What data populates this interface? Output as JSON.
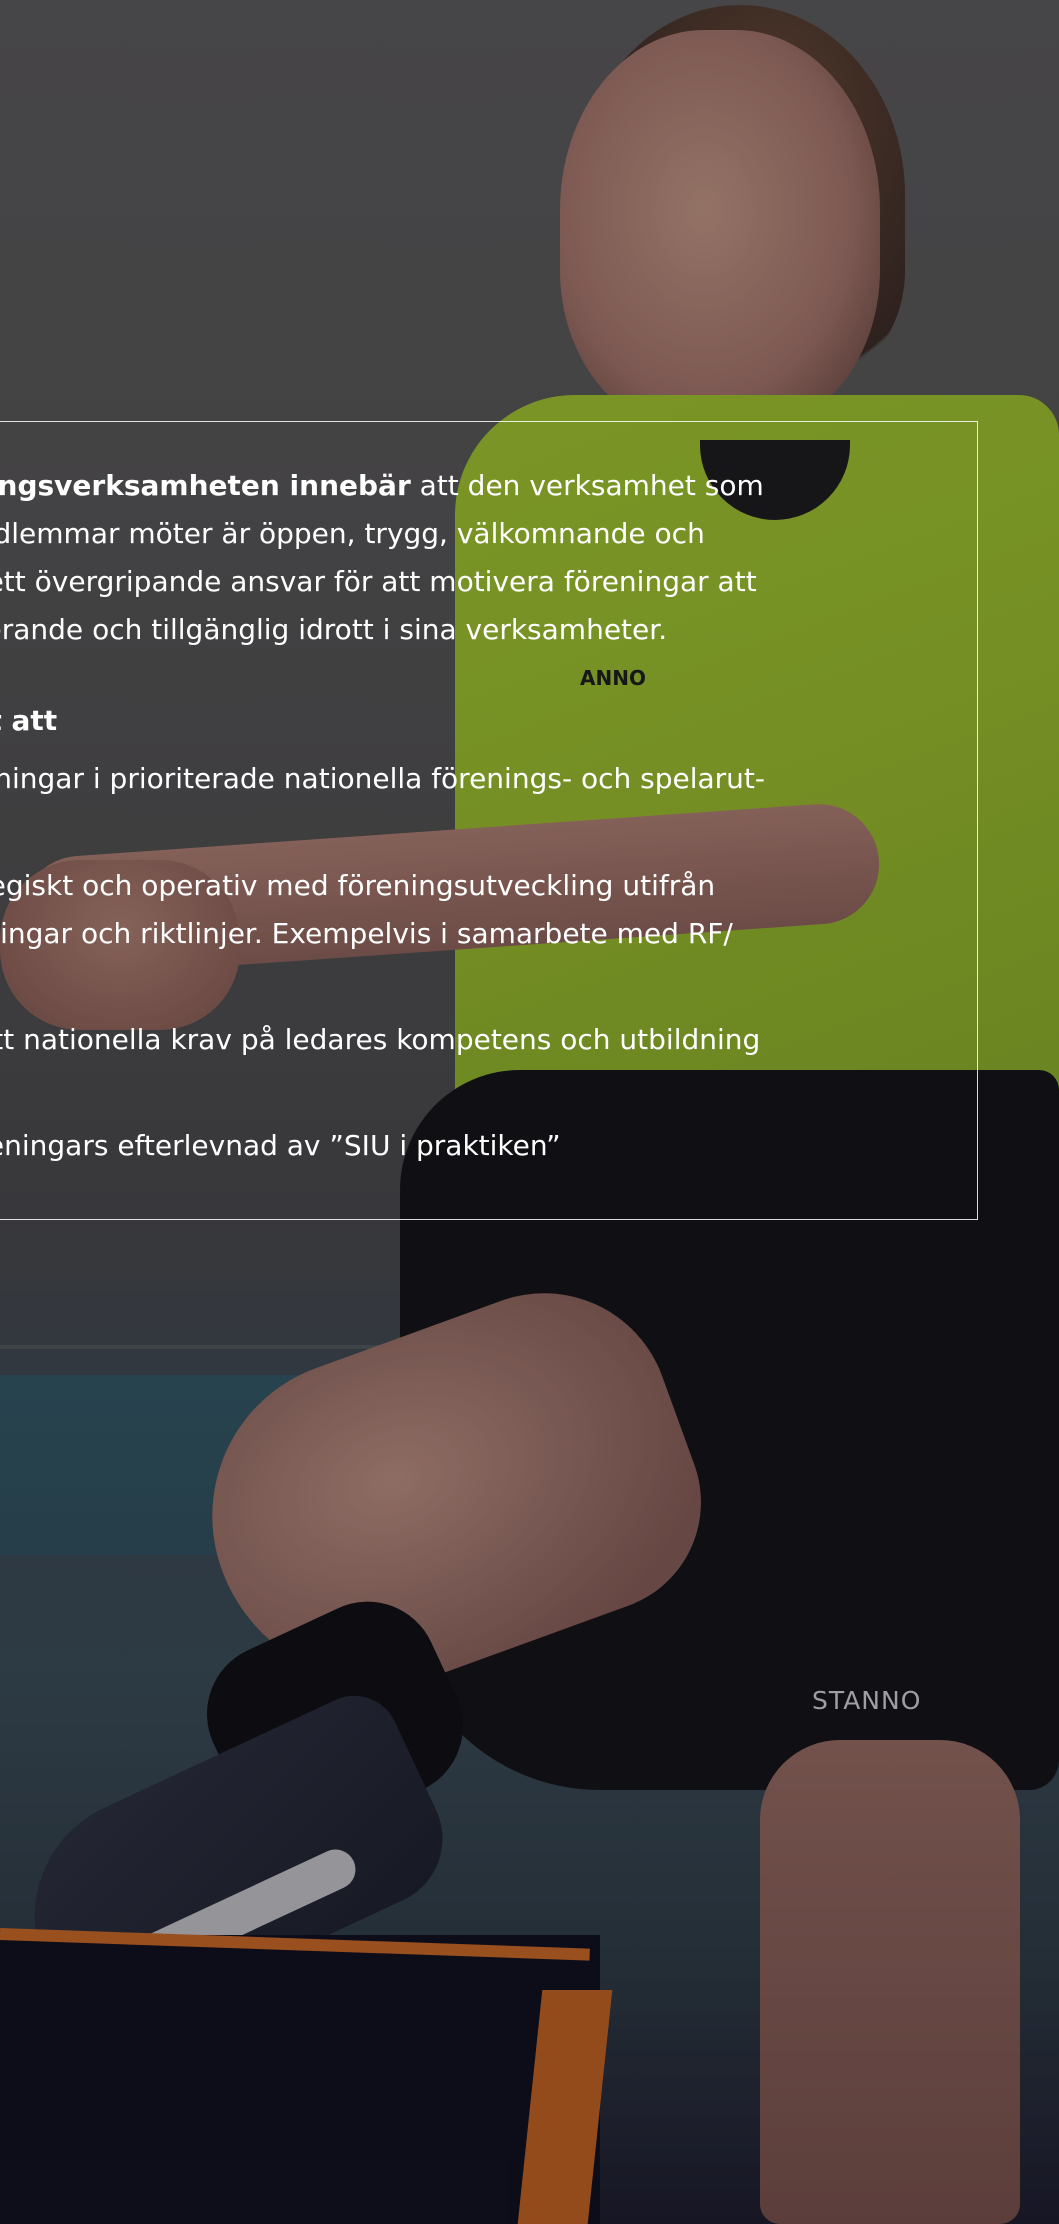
{
  "panel": {
    "intro_bold": "eningsverksamheten innebär",
    "intro_lines": [
      " att den verksamhet som",
      "medlemmar möter är öppen, trygg, välkomnande och",
      "ar ett övergripande ansvar för att motivera föreningar att",
      "uderande och tillgänglig idrott i sina verksamheter."
    ],
    "task_heading": "fikt att",
    "tasks": [
      {
        "lines": [
          "öreningar i prioriterade nationella förenings- och spelarut-"
        ]
      },
      {
        "lines": [
          "rategiskt och operativ med föreningsutveckling utifrån",
          "ildningar och riktlinjer. Exempelvis i samarbete med RF/"
        ]
      },
      {
        "lines": [
          "a att nationella krav på ledares kompetens och utbildning"
        ]
      },
      {
        "lines": [
          " föreningars efterlevnad av ”SIU i praktiken”"
        ]
      }
    ]
  },
  "photo": {
    "shorts_brand": "STANNO",
    "shirt_brand": "ANNO"
  }
}
